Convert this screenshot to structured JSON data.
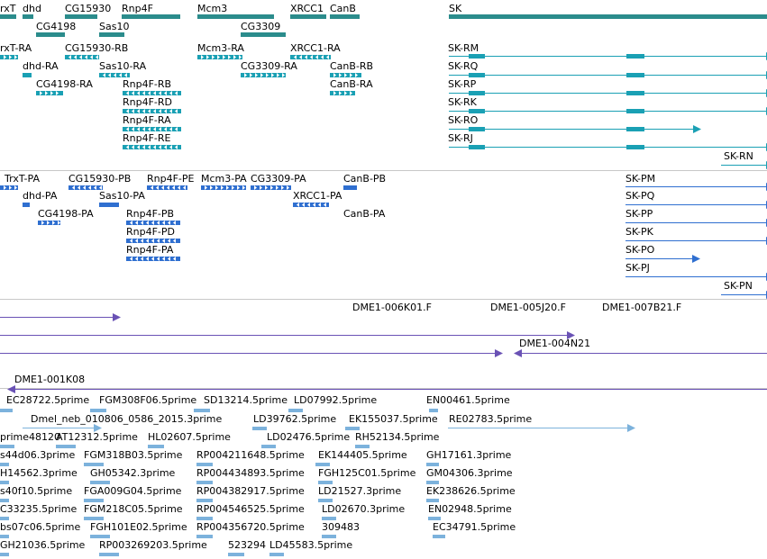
{
  "colors": {
    "gene": "#2b8c8c",
    "mrna": "#1aa0b4",
    "protein": "#2f6fd0",
    "clone": "#6a52b5",
    "est": "#7cb2dc",
    "separator": "#c8c8c8"
  },
  "tracks": {
    "gene": {
      "color_key": "gene",
      "labels": [
        {
          "id": "g1",
          "text": "rxT"
        },
        {
          "id": "g2",
          "text": "dhd"
        },
        {
          "id": "g3",
          "text": "CG15930"
        },
        {
          "id": "g4",
          "text": "Rnp4F"
        },
        {
          "id": "g5",
          "text": "Mcm3"
        },
        {
          "id": "g6",
          "text": "XRCC1"
        },
        {
          "id": "g7",
          "text": "CanB"
        },
        {
          "id": "g8",
          "text": "SK"
        },
        {
          "id": "g9",
          "text": "CG4198"
        },
        {
          "id": "g10",
          "text": "Sas10"
        },
        {
          "id": "g11",
          "text": "CG3309"
        }
      ]
    },
    "mrna": {
      "color_key": "mrna",
      "labels": [
        {
          "id": "m1",
          "text": "rxT-RA"
        },
        {
          "id": "m2",
          "text": "CG15930-RB"
        },
        {
          "id": "m3",
          "text": "Mcm3-RA"
        },
        {
          "id": "m4",
          "text": "XRCC1-RA"
        },
        {
          "id": "m5",
          "text": "SK-RM"
        },
        {
          "id": "m6",
          "text": "dhd-RA"
        },
        {
          "id": "m7",
          "text": "Sas10-RA"
        },
        {
          "id": "m8",
          "text": "CG3309-RA"
        },
        {
          "id": "m9",
          "text": "CanB-RB"
        },
        {
          "id": "m10",
          "text": "SK-RQ"
        },
        {
          "id": "m11",
          "text": "CG4198-RA"
        },
        {
          "id": "m12",
          "text": "Rnp4F-RB"
        },
        {
          "id": "m13",
          "text": "CanB-RA"
        },
        {
          "id": "m14",
          "text": "SK-RP"
        },
        {
          "id": "m15",
          "text": "Rnp4F-RD"
        },
        {
          "id": "m16",
          "text": "SK-RK"
        },
        {
          "id": "m17",
          "text": "Rnp4F-RA"
        },
        {
          "id": "m18",
          "text": "SK-RO"
        },
        {
          "id": "m19",
          "text": "Rnp4F-RE"
        },
        {
          "id": "m20",
          "text": "SK-RJ"
        },
        {
          "id": "m21",
          "text": "SK-RN"
        }
      ]
    },
    "protein": {
      "color_key": "protein",
      "labels": [
        {
          "id": "p1",
          "text": "TrxT-PA"
        },
        {
          "id": "p2",
          "text": "CG15930-PB"
        },
        {
          "id": "p3",
          "text": "Rnp4F-PE"
        },
        {
          "id": "p4",
          "text": "Mcm3-PA"
        },
        {
          "id": "p5",
          "text": "CG3309-PA"
        },
        {
          "id": "p6",
          "text": "CanB-PB"
        },
        {
          "id": "p7",
          "text": "SK-PM"
        },
        {
          "id": "p8",
          "text": "dhd-PA"
        },
        {
          "id": "p9",
          "text": "Sas10-PA"
        },
        {
          "id": "p10",
          "text": "XRCC1-PA"
        },
        {
          "id": "p11",
          "text": "SK-PQ"
        },
        {
          "id": "p12",
          "text": "CG4198-PA"
        },
        {
          "id": "p13",
          "text": "Rnp4F-PB"
        },
        {
          "id": "p14",
          "text": "CanB-PA"
        },
        {
          "id": "p15",
          "text": "SK-PP"
        },
        {
          "id": "p16",
          "text": "Rnp4F-PD"
        },
        {
          "id": "p17",
          "text": "SK-PK"
        },
        {
          "id": "p18",
          "text": "Rnp4F-PA"
        },
        {
          "id": "p19",
          "text": "SK-PO"
        },
        {
          "id": "p20",
          "text": "SK-PJ"
        },
        {
          "id": "p21",
          "text": "SK-PN"
        }
      ]
    },
    "clone": {
      "color_key": "clone",
      "labels": [
        {
          "id": "c1",
          "text": "DME1-006K01.F"
        },
        {
          "id": "c2",
          "text": "DME1-005J20.F"
        },
        {
          "id": "c3",
          "text": "DME1-007B21.F"
        },
        {
          "id": "c4",
          "text": "DME1-004N21"
        },
        {
          "id": "c5",
          "text": "DME1-001K08"
        }
      ]
    },
    "est": {
      "color_key": "est",
      "labels": [
        {
          "id": "e1",
          "text": "EC28722.5prime"
        },
        {
          "id": "e2",
          "text": "FGM308F06.5prime"
        },
        {
          "id": "e3",
          "text": "SD13214.5prime"
        },
        {
          "id": "e4",
          "text": "LD07992.5prime"
        },
        {
          "id": "e5",
          "text": "EN00461.5prime"
        },
        {
          "id": "e6",
          "text": "Dmel_neb_010806_0586_2015.3prime"
        },
        {
          "id": "e7",
          "text": "LD39762.5prime"
        },
        {
          "id": "e8",
          "text": "EK155037.5prime"
        },
        {
          "id": "e9",
          "text": "RE02783.5prime"
        },
        {
          "id": "e10",
          "text": "prime48120"
        },
        {
          "id": "e11",
          "text": "AT12312.5prime"
        },
        {
          "id": "e12",
          "text": "HL02607.5prime"
        },
        {
          "id": "e13",
          "text": "LD02476.5prime"
        },
        {
          "id": "e14",
          "text": "RH52134.5prime"
        },
        {
          "id": "e15",
          "text": "s44d06.3prime"
        },
        {
          "id": "e16",
          "text": "FGM318B03.5prime"
        },
        {
          "id": "e17",
          "text": "RP004211648.5prime"
        },
        {
          "id": "e18",
          "text": "EK144405.5prime"
        },
        {
          "id": "e19",
          "text": "GH17161.3prime"
        },
        {
          "id": "e20",
          "text": "H14562.3prime"
        },
        {
          "id": "e21",
          "text": "GH05342.3prime"
        },
        {
          "id": "e22",
          "text": "RP004434893.5prime"
        },
        {
          "id": "e23",
          "text": "FGH125C01.5prime"
        },
        {
          "id": "e24",
          "text": "GM04306.3prime"
        },
        {
          "id": "e25",
          "text": "s40f10.5prime"
        },
        {
          "id": "e26",
          "text": "FGA009G04.5prime"
        },
        {
          "id": "e27",
          "text": "RP004382917.5prime"
        },
        {
          "id": "e28",
          "text": "LD21527.3prime"
        },
        {
          "id": "e29",
          "text": "EK238626.5prime"
        },
        {
          "id": "e30",
          "text": "C33235.5prime"
        },
        {
          "id": "e31",
          "text": "FGM218C05.5prime"
        },
        {
          "id": "e32",
          "text": "RP004546525.5prime"
        },
        {
          "id": "e33",
          "text": "LD02670.3prime"
        },
        {
          "id": "e34",
          "text": "EN02948.5prime"
        },
        {
          "id": "e35",
          "text": "bs07c06.5prime"
        },
        {
          "id": "e36",
          "text": "FGH101E02.5prime"
        },
        {
          "id": "e37",
          "text": "RP004356720.5prime"
        },
        {
          "id": "e38",
          "text": "309483"
        },
        {
          "id": "e39",
          "text": "EC34791.5prime"
        },
        {
          "id": "e40",
          "text": "GH21036.5prime"
        },
        {
          "id": "e41",
          "text": "RP003269203.5prime"
        },
        {
          "id": "e42",
          "text": "523294"
        },
        {
          "id": "e43",
          "text": "LD45583.5prime"
        }
      ]
    }
  }
}
